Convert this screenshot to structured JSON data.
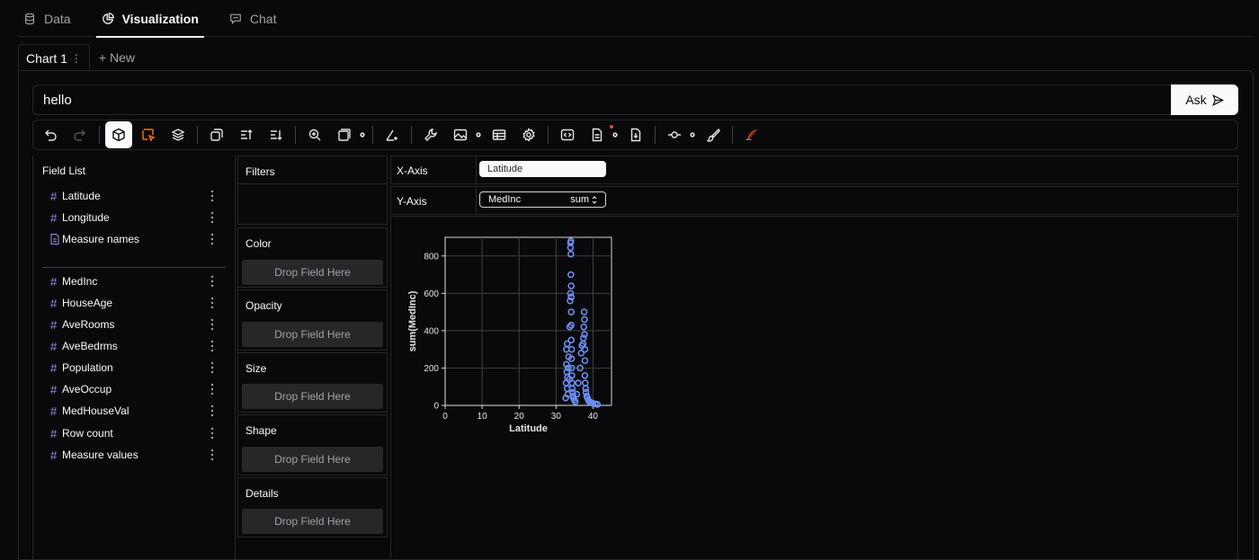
{
  "top_tabs": [
    {
      "label": "Data",
      "icon": "database-icon"
    },
    {
      "label": "Visualization",
      "icon": "pie-chart-icon",
      "active": true
    },
    {
      "label": "Chat",
      "icon": "chat-icon"
    }
  ],
  "chart_tabs": {
    "active_label": "Chart 1",
    "new_label": "+ New"
  },
  "prompt": {
    "value": "hello",
    "ask_label": "Ask"
  },
  "toolbar": {
    "buttons": [
      "undo-icon",
      "redo-icon",
      "cube-icon",
      "select-box-icon",
      "layers-icon",
      "transpose-icon",
      "sort-ascending-icon",
      "sort-descending-icon",
      "zoom-in-icon",
      "size-mode-icon",
      "axis-icon",
      "wrench-icon",
      "image-icon",
      "table-icon",
      "gear-icon",
      "code-icon",
      "document-icon",
      "export-icon",
      "pan-point-icon",
      "brush-icon",
      "quill-icon"
    ]
  },
  "field_list": {
    "title": "Field List",
    "dimensions": [
      {
        "name": "Latitude",
        "type": "number"
      },
      {
        "name": "Longitude",
        "type": "number"
      },
      {
        "name": "Measure names",
        "type": "text"
      }
    ],
    "measures": [
      {
        "name": "MedInc"
      },
      {
        "name": "HouseAge"
      },
      {
        "name": "AveRooms"
      },
      {
        "name": "AveBedrms"
      },
      {
        "name": "Population"
      },
      {
        "name": "AveOccup"
      },
      {
        "name": "MedHouseVal"
      },
      {
        "name": "Row count"
      },
      {
        "name": "Measure values"
      }
    ]
  },
  "filters": {
    "label": "Filters"
  },
  "encodings": [
    {
      "label": "Color",
      "drop": "Drop Field Here"
    },
    {
      "label": "Opacity",
      "drop": "Drop Field Here"
    },
    {
      "label": "Size",
      "drop": "Drop Field Here"
    },
    {
      "label": "Shape",
      "drop": "Drop Field Here"
    },
    {
      "label": "Details",
      "drop": "Drop Field Here"
    }
  ],
  "x_axis": {
    "label": "X-Axis",
    "field": "Latitude"
  },
  "y_axis": {
    "label": "Y-Axis",
    "field": "MedInc",
    "aggregate": "sum"
  },
  "colors": {
    "accent": "#6b8ff0",
    "background": "#09090b",
    "border": "#27272a",
    "orange": "#f97316"
  },
  "chart_data": {
    "type": "scatter",
    "xlabel": "Latitude",
    "ylabel": "sum(MedInc)",
    "xlim": [
      0,
      45
    ],
    "ylim": [
      0,
      900
    ],
    "xticks": [
      0,
      10,
      20,
      30,
      40
    ],
    "yticks": [
      0,
      200,
      400,
      600,
      800
    ],
    "grid": true,
    "series": [
      {
        "x": [
          32.6,
          32.7,
          32.8,
          32.8,
          32.9,
          33.0,
          33.0,
          33.1,
          33.2,
          33.3,
          33.4,
          33.6,
          33.7,
          33.8,
          33.9,
          33.9,
          33.9,
          34.0,
          34.0,
          34.0,
          34.1,
          34.1,
          34.1,
          34.1,
          34.1,
          34.2,
          34.2,
          34.2,
          34.3,
          34.3,
          34.4,
          34.5,
          34.6,
          34.7,
          34.9,
          35.2,
          35.6,
          36.0,
          36.5,
          36.8,
          37.0,
          37.3,
          37.4,
          37.5,
          37.6,
          37.7,
          37.7,
          37.8,
          37.8,
          37.8,
          37.9,
          38.0,
          38.1,
          38.3,
          38.5,
          38.7,
          39.0,
          39.5,
          40.0,
          40.6,
          41.2
        ],
        "y": [
          40,
          120,
          220,
          300,
          180,
          90,
          330,
          150,
          60,
          200,
          260,
          140,
          420,
          560,
          870,
          845,
          600,
          880,
          810,
          700,
          640,
          580,
          500,
          430,
          350,
          300,
          250,
          200,
          160,
          120,
          90,
          70,
          50,
          40,
          30,
          20,
          60,
          120,
          200,
          280,
          320,
          330,
          360,
          420,
          500,
          460,
          380,
          300,
          240,
          160,
          120,
          90,
          70,
          50,
          40,
          30,
          20,
          15,
          10,
          8,
          5
        ]
      }
    ]
  }
}
